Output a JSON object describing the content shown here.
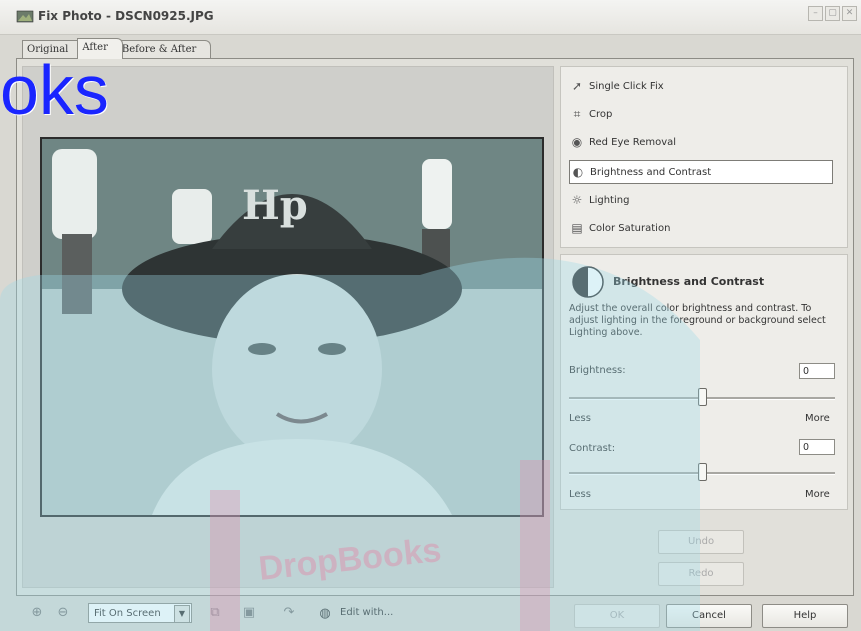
{
  "window": {
    "title": "Fix Photo - DSCN0925.JPG",
    "controls": [
      "–",
      "▢",
      "✕"
    ]
  },
  "tabs": [
    {
      "label": "Original"
    },
    {
      "label": "After"
    },
    {
      "label": "Before & After"
    }
  ],
  "active_tab": "After",
  "tools": [
    {
      "label": "Single Click Fix",
      "icon": "cursor-icon"
    },
    {
      "label": "Crop",
      "icon": "crop-icon"
    },
    {
      "label": "Red Eye Removal",
      "icon": "eye-icon"
    },
    {
      "label": "Brightness and Contrast",
      "icon": "brightness-icon",
      "selected": true
    },
    {
      "label": "Lighting",
      "icon": "sun-icon"
    },
    {
      "label": "Color Saturation",
      "icon": "color-saturation-icon"
    }
  ],
  "panel": {
    "title": "Brightness and Contrast",
    "description": "Adjust the overall color brightness and contrast. To adjust lighting in the foreground or background select Lighting above.",
    "brightness_label": "Brightness:",
    "brightness_value": "0",
    "contrast_label": "Contrast:",
    "contrast_value": "0",
    "less_label": "Less",
    "more_label": "More",
    "brightness_level": 0.5,
    "contrast_level": 0.5
  },
  "buttons": {
    "undo": "Undo",
    "redo": "Redo",
    "ok": "OK",
    "cancel": "Cancel",
    "help": "Help"
  },
  "bottombar": {
    "zoom_value": "Fit On Screen",
    "edit_with": "Edit with..."
  },
  "watermark": {
    "text": "oks",
    "stamp": "DropBooks"
  },
  "colors": {
    "watermark_text": "#1a25ff",
    "overlay_cyan": "#9fdbe8",
    "overlay_pink": "#e08aa8"
  }
}
